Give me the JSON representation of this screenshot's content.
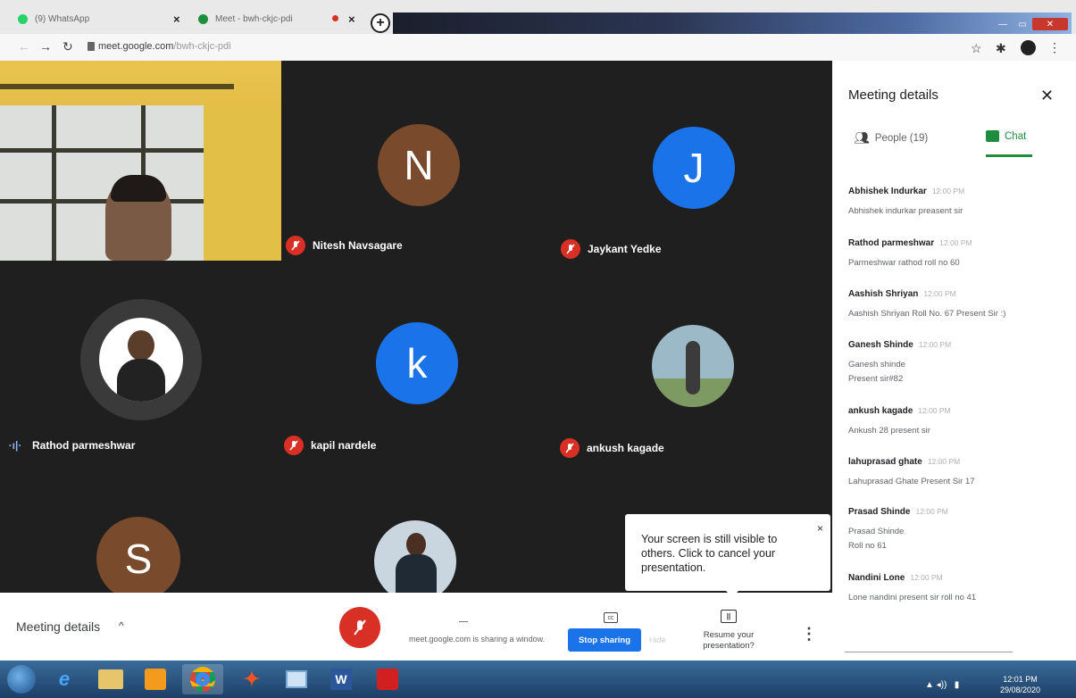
{
  "browser": {
    "tabs": [
      {
        "title": "(9) WhatsApp",
        "close": "×"
      },
      {
        "title": "Meet - bwh-ckjc-pdi",
        "close": "×"
      }
    ],
    "new_tab": "+",
    "url_host": "meet.google.com",
    "url_path": "/bwh-ckjc-pdi"
  },
  "participants": [
    {
      "name": "Nitesh Navsagare",
      "initial": "N",
      "color": "#7a4a2c",
      "muted": true
    },
    {
      "name": "Jaykant Yedke",
      "initial": "J",
      "color": "#1a73e8",
      "muted": true
    },
    {
      "name": "Rathod parmeshwar",
      "initial": "",
      "color": "#ffffff",
      "muted": false
    },
    {
      "name": "kapil nardele",
      "initial": "k",
      "color": "#1a73e8",
      "muted": true
    },
    {
      "name": "ankush kagade",
      "initial": "",
      "color": "#9bb9c7",
      "muted": true
    },
    {
      "name": "",
      "initial": "S",
      "color": "#7a4a2c",
      "muted": false
    },
    {
      "name": "",
      "initial": "",
      "color": "#c9d6df",
      "muted": false
    }
  ],
  "popup": {
    "text": "Your screen is still visible to others. Click to cancel your presentation.",
    "close": "×"
  },
  "panel": {
    "title": "Meeting details",
    "people_tab": "People (19)",
    "chat_tab": "Chat",
    "messages": [
      {
        "sender": "Abhishek Indurkar",
        "time": "12:00 PM",
        "text": "Abhishek indurkar preasent sir"
      },
      {
        "sender": "Rathod parmeshwar",
        "time": "12:00 PM",
        "text": "Parmeshwar rathod roll no 60"
      },
      {
        "sender": "Aashish Shriyan",
        "time": "12:00 PM",
        "text": "Aashish Shriyan Roll No. 67 Present Sir :)"
      },
      {
        "sender": "Ganesh Shinde",
        "time": "12:00 PM",
        "text": "Ganesh shinde\nPresent sir#82"
      },
      {
        "sender": "ankush kagade",
        "time": "12:00 PM",
        "text": "Ankush 28 present sir"
      },
      {
        "sender": "lahuprasad ghate",
        "time": "12:00 PM",
        "text": "Lahuprasad Ghate Present Sir 17"
      },
      {
        "sender": "Prasad Shinde",
        "time": "12:00 PM",
        "text": "Prasad Shinde\nRoll no 61"
      },
      {
        "sender": "Nandini Lone",
        "time": "12:00 PM",
        "text": "Lone nandini present sir roll no 41"
      }
    ]
  },
  "bottom": {
    "meeting_details": "Meeting details",
    "sharing_text": "meet.google.com is sharing a window.",
    "stop_sharing": "Stop sharing",
    "hide": "Hide",
    "resume": "Resume your presentation?"
  },
  "taskbar": {
    "time": "12:01 PM",
    "date": "29/08/2020"
  },
  "colors": {
    "accent_blue": "#1a73e8",
    "mute_red": "#d93025",
    "chat_green": "#1e8e3e"
  }
}
